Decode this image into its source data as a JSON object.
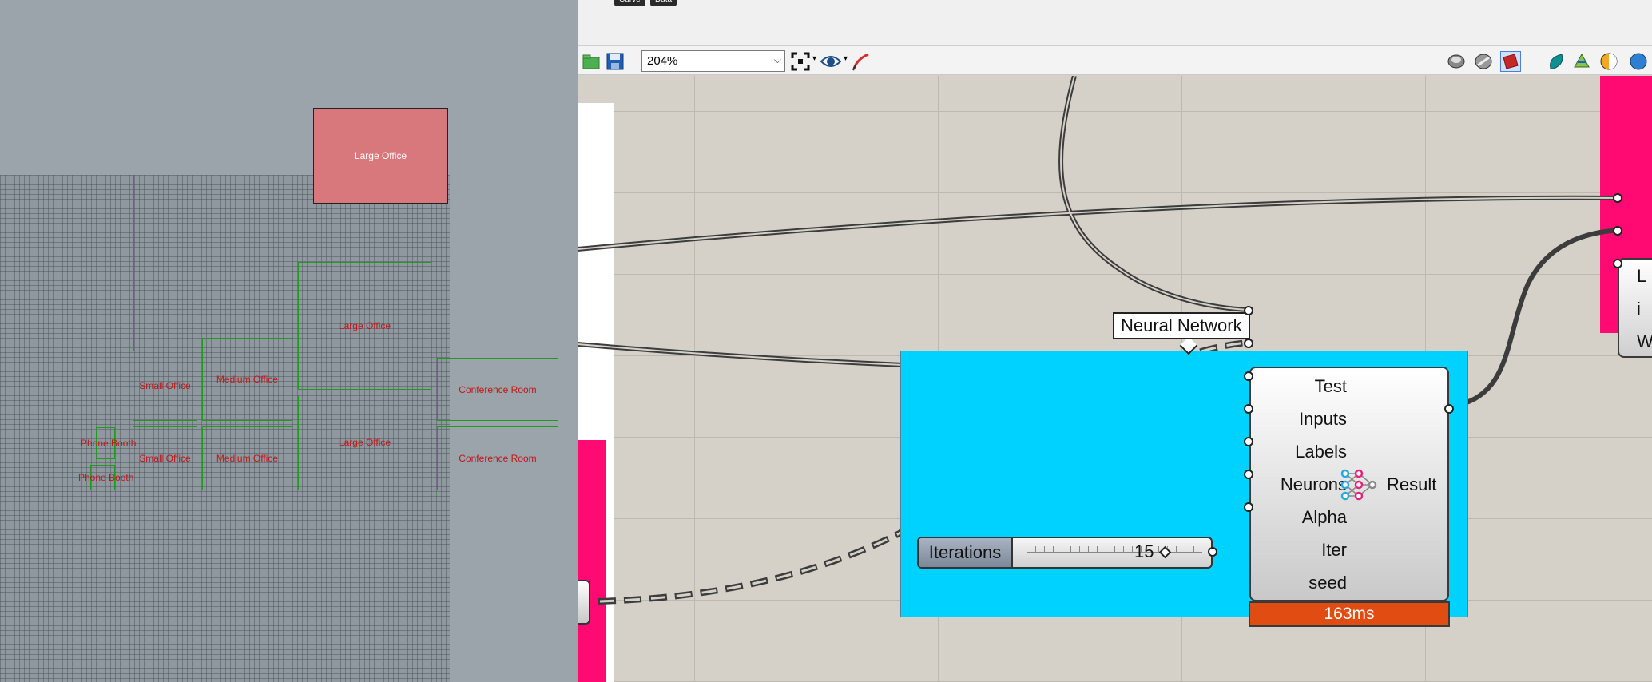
{
  "rhino": {
    "rooms": [
      {
        "id": "large-office-selected",
        "label": "Large Office",
        "selected": true
      },
      {
        "id": "large-office-1",
        "label": "Large Office"
      },
      {
        "id": "large-office-2",
        "label": "Large Office"
      },
      {
        "id": "small-office-1",
        "label": "Small Office"
      },
      {
        "id": "small-office-2",
        "label": "Small Office"
      },
      {
        "id": "medium-office-1",
        "label": "Medium Office"
      },
      {
        "id": "medium-office-2",
        "label": "Medium Office"
      },
      {
        "id": "conference-room-1",
        "label": "Conference Room"
      },
      {
        "id": "conference-room-2",
        "label": "Conference Room"
      },
      {
        "id": "phone-booth-1",
        "label": "Phone Booth"
      },
      {
        "id": "phone-booth-2",
        "label": "Phone Booth"
      }
    ]
  },
  "grasshopper": {
    "top_tabs": [
      "Curve",
      "Data"
    ],
    "toolbar": {
      "zoom_value": "204%",
      "icons_left": [
        "open-file-icon",
        "save-icon",
        "zoom-extents-icon",
        "preview-eye-icon",
        "sketch-pen-icon"
      ],
      "icons_right": [
        "preview-wire-icon",
        "preview-shaded-icon",
        "preview-selected-icon",
        "bake-icon",
        "display-mesh-icon",
        "material-icon",
        "sphere-icon"
      ]
    },
    "group": {
      "label": "Neural Network",
      "color": "#00d2ff"
    },
    "component": {
      "inputs": [
        "Test",
        "Inputs",
        "Labels",
        "Neurons",
        "Alpha",
        "Iter",
        "seed"
      ],
      "output": "Result",
      "icon": "neural-network-icon",
      "timing": "163ms"
    },
    "slider": {
      "name": "Iterations",
      "value": "15"
    },
    "right_component_inputs": [
      "L",
      "i",
      "W"
    ]
  }
}
